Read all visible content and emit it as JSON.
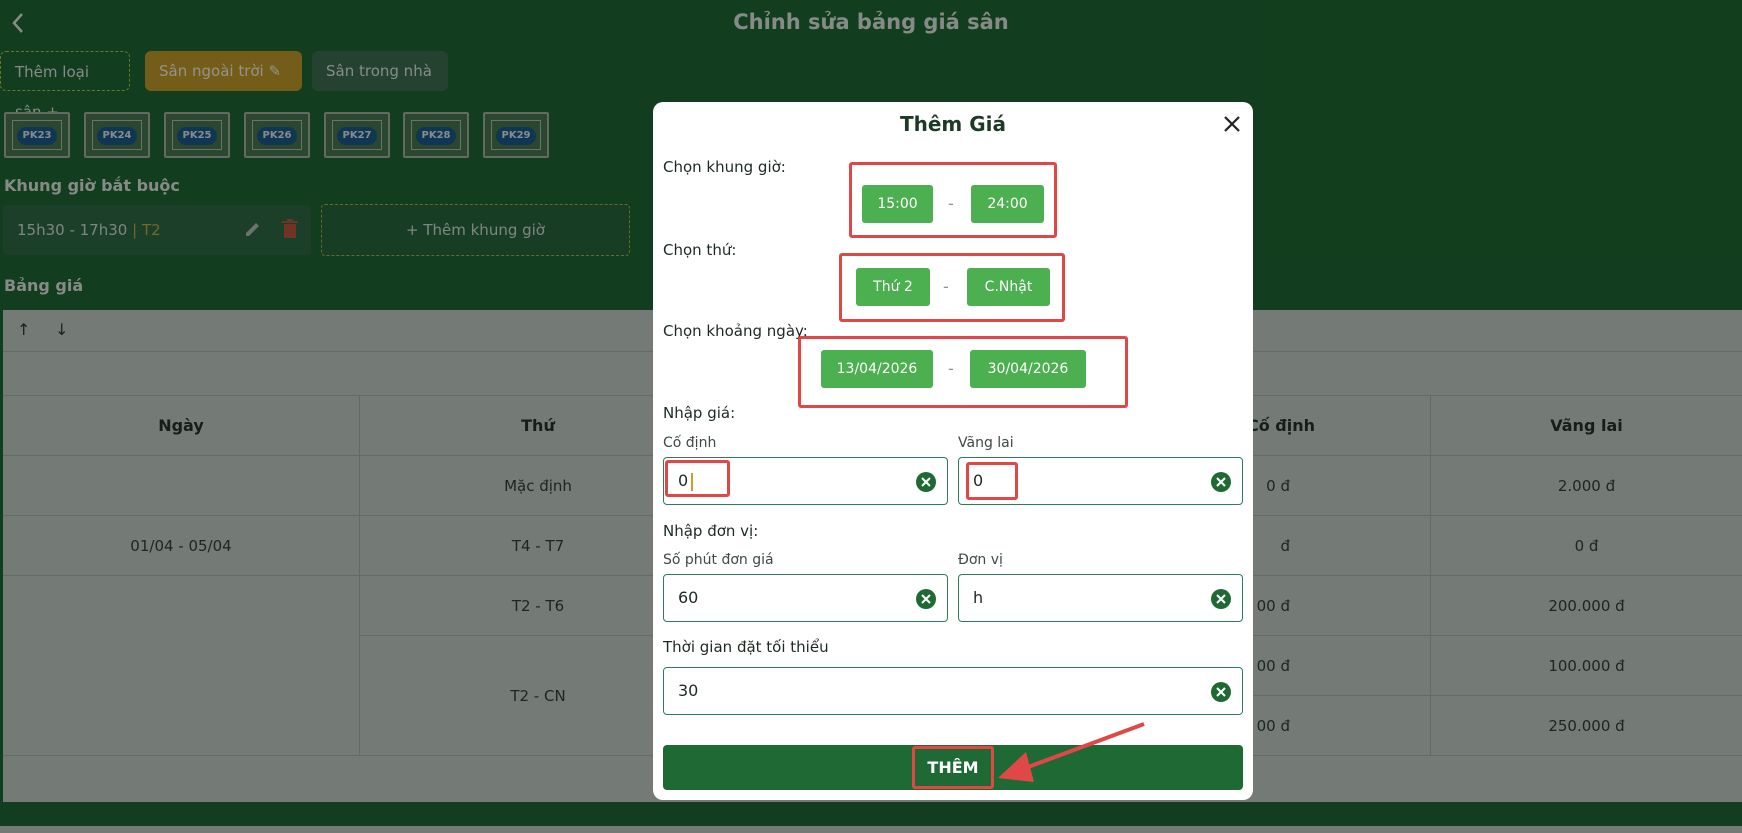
{
  "header": {
    "title": "Chỉnh sửa bảng giá sân"
  },
  "categories": {
    "add_label": "Thêm loại sân",
    "outdoor_label": "Sân ngoài trời",
    "indoor_label": "Sân trong nhà"
  },
  "courts": [
    "PK23",
    "PK24",
    "PK25",
    "PK26",
    "PK27",
    "PK28",
    "PK29"
  ],
  "mandatory": {
    "title": "Khung giờ bắt buộc",
    "slot_time": "15h30 - 17h30",
    "slot_sep": "|",
    "slot_day": "T2",
    "add_label": "Thêm khung giờ"
  },
  "price_table": {
    "title": "Bảng giá",
    "headers": {
      "date": "Ngày",
      "weekday": "Thứ",
      "fixed": "Cố định",
      "walkin": "Vãng lai"
    },
    "rows": [
      {
        "date": "",
        "weekday": "Mặc định",
        "fixed": "0 đ",
        "walkin": "2.000 đ"
      },
      {
        "date": "01/04 - 05/04",
        "weekday": "T4 - T7",
        "fixed": "đ",
        "walkin": "0 đ"
      },
      {
        "date": "",
        "weekday": "T2 - T6",
        "fixed": "00 đ",
        "walkin": "200.000 đ"
      },
      {
        "date": "",
        "weekday": "T2 - CN",
        "fixed": "00 đ",
        "walkin": "100.000 đ"
      },
      {
        "date": "",
        "weekday": "",
        "fixed": "00 đ",
        "walkin": "250.000 đ"
      }
    ]
  },
  "modal": {
    "title": "Thêm Giá",
    "time_label": "Chọn khung giờ:",
    "time_from": "15:00",
    "time_to": "24:00",
    "weekday_label": "Chọn thứ:",
    "weekday_from": "Thứ 2",
    "weekday_to": "C.Nhật",
    "date_label": "Chọn khoảng ngày:",
    "date_from": "13/04/2026",
    "date_to": "30/04/2026",
    "separator": "-",
    "price_label": "Nhập giá:",
    "fixed_label": "Cố định",
    "fixed_value": "0",
    "walkin_label": "Vãng lai",
    "walkin_value": "0",
    "unit_section_label": "Nhập đơn vị:",
    "minutes_label": "Số phút đơn giá",
    "minutes_value": "60",
    "unit_label": "Đơn vị",
    "unit_value": "h",
    "min_time_label": "Thời gian đặt tối thiểu",
    "min_time_value": "30",
    "submit_label": "THÊM"
  },
  "colors": {
    "primary": "#1f6a34",
    "pill": "#4caf50",
    "accent": "#c9a02c",
    "annotation": "#e04848"
  }
}
